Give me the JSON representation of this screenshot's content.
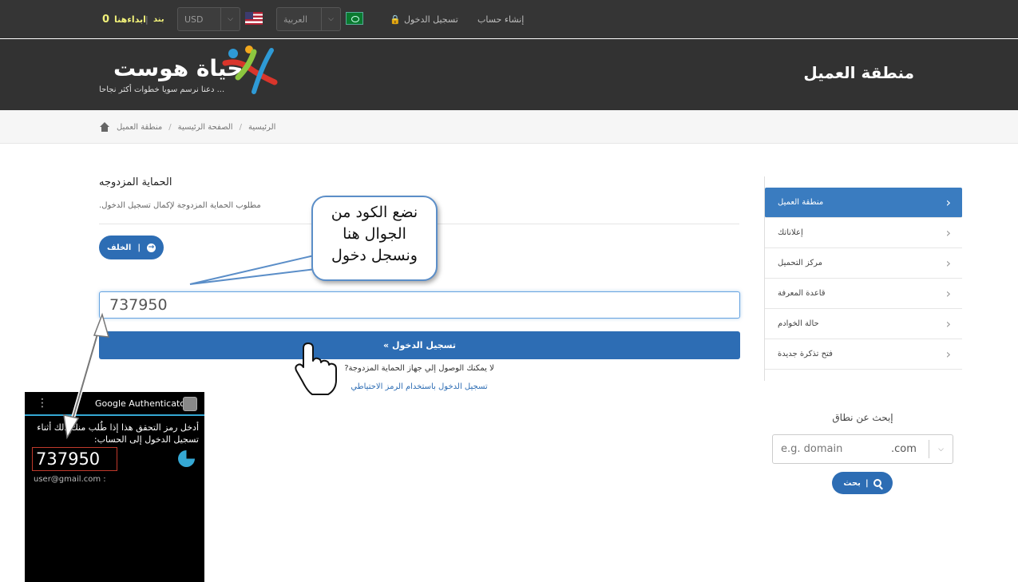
{
  "topbar": {
    "cart_label": "ابداءهنا",
    "cart_count": "0",
    "separator": "|",
    "band_label": "بند",
    "currency": "USD",
    "language": "العربية",
    "login": "تسجيل الدخول",
    "register": "إنشاء حساب"
  },
  "header": {
    "title": "منطقة العميل",
    "logo_name": "حياة هوست",
    "logo_tagline": "دعنا نرسم سويا خطوات أكثر نجاحا ..."
  },
  "breadcrumb": {
    "items": [
      "منطقة العميل",
      "الصفحة الرئيسية",
      "الرئيسية"
    ],
    "separator": "/"
  },
  "main": {
    "title": "الحماية المزدوجه",
    "subtitle": ".مطلوب الحماية المزدوجة لإكمال تسجيل الدخول",
    "back_label": "الخلف",
    "back_sep": "|",
    "code_value": "737950",
    "login_button": "« تسجيل الدخول",
    "no_device": "?لا يمكنك الوصول إلي جهاز الحماية المزدوجة",
    "backup_link": "تسجيل الدخول باستخدام الرمز الاحتياطي"
  },
  "callout": {
    "lines": [
      "نضع الكود من",
      "الجوال هنا",
      "ونسجل دخول"
    ]
  },
  "sidebar": {
    "items": [
      {
        "label": "منطقة العميل"
      },
      {
        "label": "إعلاناتك"
      },
      {
        "label": "مركز التحميل"
      },
      {
        "label": "قاعدة المعرفة"
      },
      {
        "label": "حالة الخوادم"
      },
      {
        "label": "فتح تذكرة جديدة"
      }
    ]
  },
  "domain_search": {
    "title": "إبحث عن نطاق",
    "placeholder": "e.g. domain",
    "tld": ".com",
    "button": "بحث",
    "button_sep": "|"
  },
  "phone": {
    "app_name": "Google Authenticator",
    "menu_glyph": "⋮",
    "prompt": "أدخل رمز التحقق هذا إذا طُلب منك ذلك أثناء تسجيل الدخول إلى الحساب:",
    "code": "737950",
    "account": "user@gmail.com :"
  },
  "colors": {
    "primary": "#2d6db4",
    "topbar": "#353535",
    "header": "#323232",
    "cart_accent": "#f2f27a",
    "phone_accent": "#35a8d4"
  }
}
